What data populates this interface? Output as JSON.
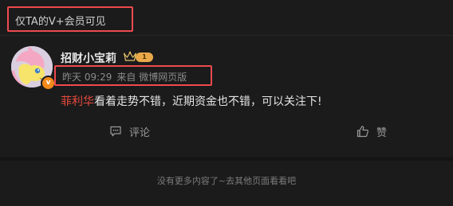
{
  "visibility": {
    "label": "仅TA的V+会员可见"
  },
  "post": {
    "username": "招财小宝莉",
    "level": "1",
    "verified_mark": "v",
    "time": "昨天 09:29",
    "source": "来自 微博网页版",
    "link_text": "菲利华",
    "text": "看着走势不错，近期资金也不错，可以关注下!",
    "avatar_icon": "pony-avatar"
  },
  "actions": {
    "comment_label": "评论",
    "like_label": "赞"
  },
  "footer": {
    "end_text": "没有更多内容了~去其他页面看看吧"
  },
  "colors": {
    "accent_highlight": "#ee4a4f",
    "link": "#e8493f",
    "badge_orange": "#f28a1c"
  }
}
